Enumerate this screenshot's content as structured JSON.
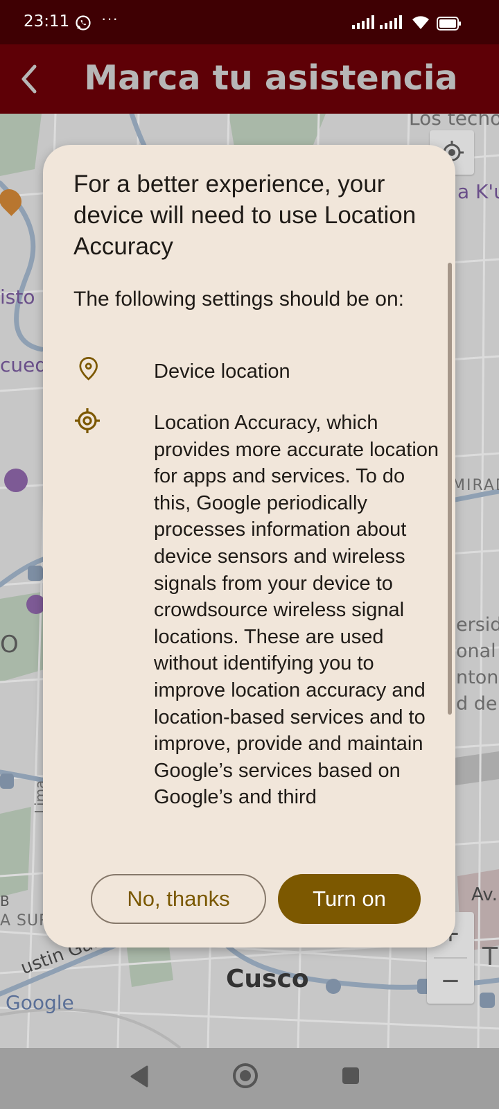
{
  "status_bar": {
    "time": "23:11",
    "more": "···"
  },
  "app_bar": {
    "title": "Marca tu asistencia"
  },
  "map": {
    "labels": [
      "Los techo",
      "a K'u",
      "isto I",
      "cuedu",
      "MIRAD",
      "ersid",
      "onal",
      "nton",
      "d de",
      "Av.",
      "A SUR",
      "ustin Gamarra",
      "Cusco",
      "Google",
      "Lima",
      "T",
      "O",
      "B"
    ],
    "zoom_in": "+",
    "zoom_out": "−"
  },
  "dialog": {
    "title": "For a better experience, your device will need to use Location Accuracy",
    "subtitle": "The following settings should be on:",
    "items": [
      {
        "icon": "location-pin-icon",
        "text": "Device location"
      },
      {
        "icon": "gps-target-icon",
        "text": "Location Accuracy, which provides more accurate location for apps and services. To do this, Google periodically processes information about device sensors and wireless signals from your device to crowdsource wireless signal locations. These are used without identifying you to improve location accuracy and location-based services and to improve, provide and maintain Google’s services based on Google’s and third"
      }
    ],
    "no_button": "No, thanks",
    "yes_button": "Turn on"
  },
  "colors": {
    "accent": "#7c5800",
    "appbar": "#5e0006",
    "statusbar": "#3f0003",
    "dialog_bg": "#f1e6da"
  }
}
